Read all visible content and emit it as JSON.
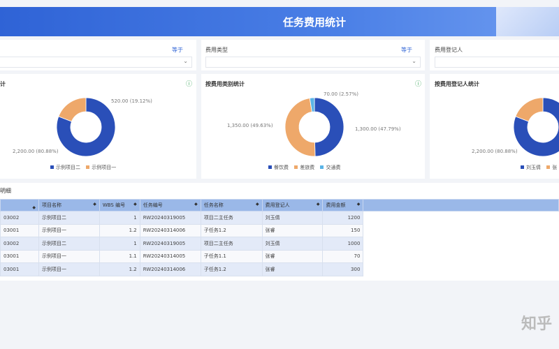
{
  "header": {
    "title": "任务费用统计"
  },
  "filters": [
    {
      "label": "",
      "operator": "等于"
    },
    {
      "label": "费用类型",
      "operator": "等于"
    },
    {
      "label": "费用登记人",
      "operator": ""
    }
  ],
  "charts": [
    {
      "title": "计",
      "slices": [
        {
          "name": "示例项目二",
          "value": 2200,
          "label": "2,200.00 (80.88%)",
          "color": "#2a4fb8"
        },
        {
          "name": "示例项目一",
          "value": 520,
          "label": "520.00 (19.12%)",
          "color": "#eea86a"
        }
      ]
    },
    {
      "title": "按费用类别统计",
      "slices": [
        {
          "name": "餐饮费",
          "value": 1350,
          "label": "1,350.00 (49.63%)",
          "color": "#2a4fb8"
        },
        {
          "name": "差旅费",
          "value": 1300,
          "label": "1,300.00 (47.79%)",
          "color": "#eea86a"
        },
        {
          "name": "交通费",
          "value": 70,
          "label": "70.00 (2.57%)",
          "color": "#5ab4e6"
        }
      ]
    },
    {
      "title": "按费用登记人统计",
      "slices": [
        {
          "name": "刘玉倩",
          "value": 2200,
          "label": "2,200.00 (80.88%)",
          "color": "#2a4fb8"
        },
        {
          "name": "张",
          "value": 520,
          "label": "",
          "color": "#eea86a"
        }
      ]
    }
  ],
  "table": {
    "title": "明细",
    "columns": [
      "",
      "项目名称",
      "WBS 编号",
      "任务编号",
      "任务名称",
      "费用登记人",
      "费用金额"
    ],
    "rows": [
      [
        "03002",
        "示例项目二",
        "1",
        "RW20240319005",
        "项目二主任务",
        "刘玉倩",
        "1200"
      ],
      [
        "03001",
        "示例项目一",
        "1.2",
        "RW20240314006",
        "子任务1.2",
        "张睿",
        "150"
      ],
      [
        "03002",
        "示例项目二",
        "1",
        "RW20240319005",
        "项目二主任务",
        "刘玉倩",
        "1000"
      ],
      [
        "03001",
        "示例项目一",
        "1.1",
        "RW20240314005",
        "子任务1.1",
        "张睿",
        "70"
      ],
      [
        "03001",
        "示例项目一",
        "1.2",
        "RW20240314006",
        "子任务1.2",
        "张睿",
        "300"
      ]
    ]
  },
  "watermark": "知乎"
}
